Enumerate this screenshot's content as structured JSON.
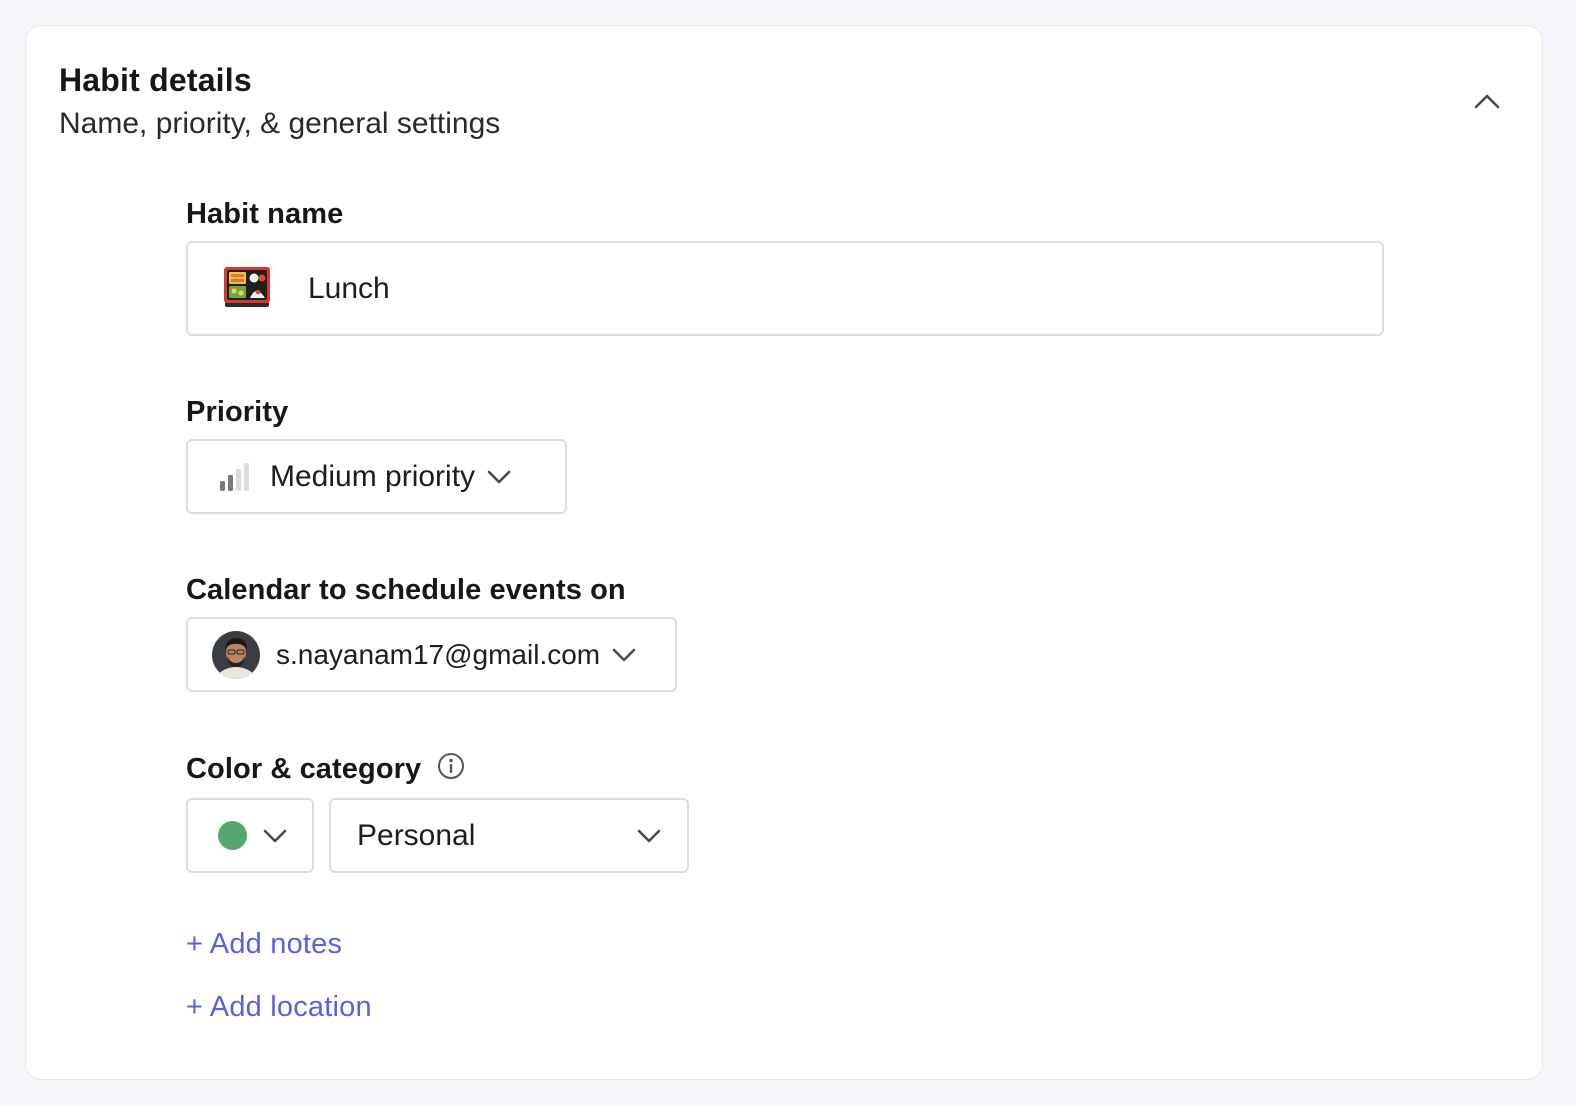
{
  "section": {
    "title": "Habit details",
    "subtitle": "Name, priority, & general settings",
    "collapse_icon": "chevron-up-icon"
  },
  "habit_name": {
    "label": "Habit name",
    "value": "Lunch",
    "emoji_icon": "bento-box-icon"
  },
  "priority": {
    "label": "Priority",
    "value": "Medium priority",
    "icon": "signal-bars-icon"
  },
  "calendar": {
    "label": "Calendar to schedule events on",
    "value": "s.nayanam17@gmail.com",
    "avatar_icon": "user-avatar"
  },
  "color_category": {
    "label": "Color & category",
    "info_icon": "info-icon",
    "color": "#54a770",
    "category": "Personal"
  },
  "links": {
    "add_notes": "+ Add notes",
    "add_location": "+ Add location"
  },
  "colors": {
    "link": "#5b5fe0",
    "border": "#dcdde1",
    "background": "#f6f7fa"
  }
}
